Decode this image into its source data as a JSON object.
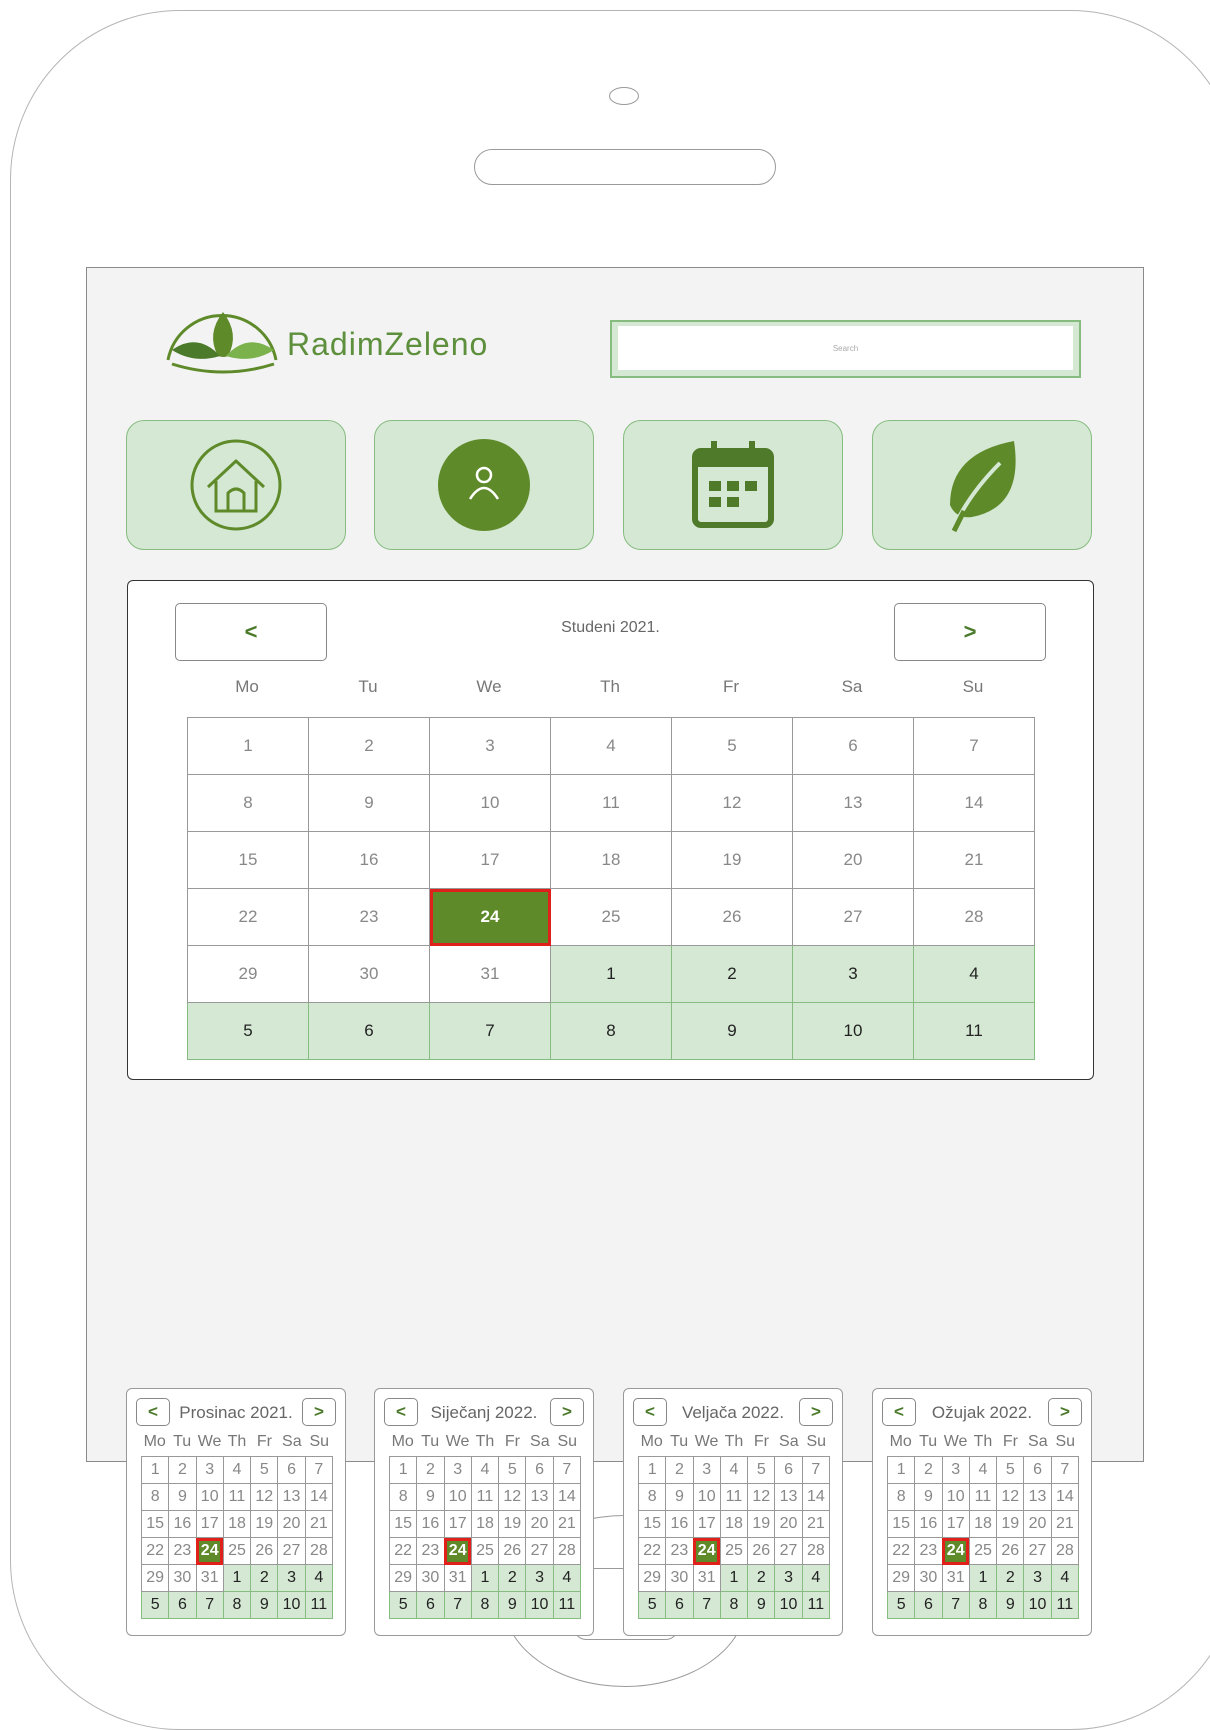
{
  "app": {
    "logo_text": "RadimZeleno"
  },
  "search": {
    "placeholder": "Search"
  },
  "nav": [
    {
      "icon": "home-icon"
    },
    {
      "icon": "user-icon"
    },
    {
      "icon": "calendar-icon"
    },
    {
      "icon": "leaf-icon"
    }
  ],
  "calendar": {
    "title": "Studeni 2021.",
    "prev_label": "<",
    "next_label": ">",
    "weekdays": [
      "Mo",
      "Tu",
      "We",
      "Th",
      "Fr",
      "Sa",
      "Su"
    ],
    "selected_day": "24",
    "weeks": [
      [
        "1",
        "2",
        "3",
        "4",
        "5",
        "6",
        "7"
      ],
      [
        "8",
        "9",
        "10",
        "11",
        "12",
        "13",
        "14"
      ],
      [
        "15",
        "16",
        "17",
        "18",
        "19",
        "20",
        "21"
      ],
      [
        "22",
        "23",
        "24",
        "25",
        "26",
        "27",
        "28"
      ],
      [
        "29",
        "30",
        "31",
        "1",
        "2",
        "3",
        "4"
      ],
      [
        "5",
        "6",
        "7",
        "8",
        "9",
        "10",
        "11"
      ]
    ]
  },
  "mini_calendars": [
    {
      "title": "Prosinac 2021."
    },
    {
      "title": "Siječanj 2022."
    },
    {
      "title": "Veljača 2022."
    },
    {
      "title": "Ožujak 2022."
    }
  ],
  "colors": {
    "accent": "#5e8a2a",
    "light_green": "#d5e8d4",
    "selected_border": "#e0201a"
  }
}
